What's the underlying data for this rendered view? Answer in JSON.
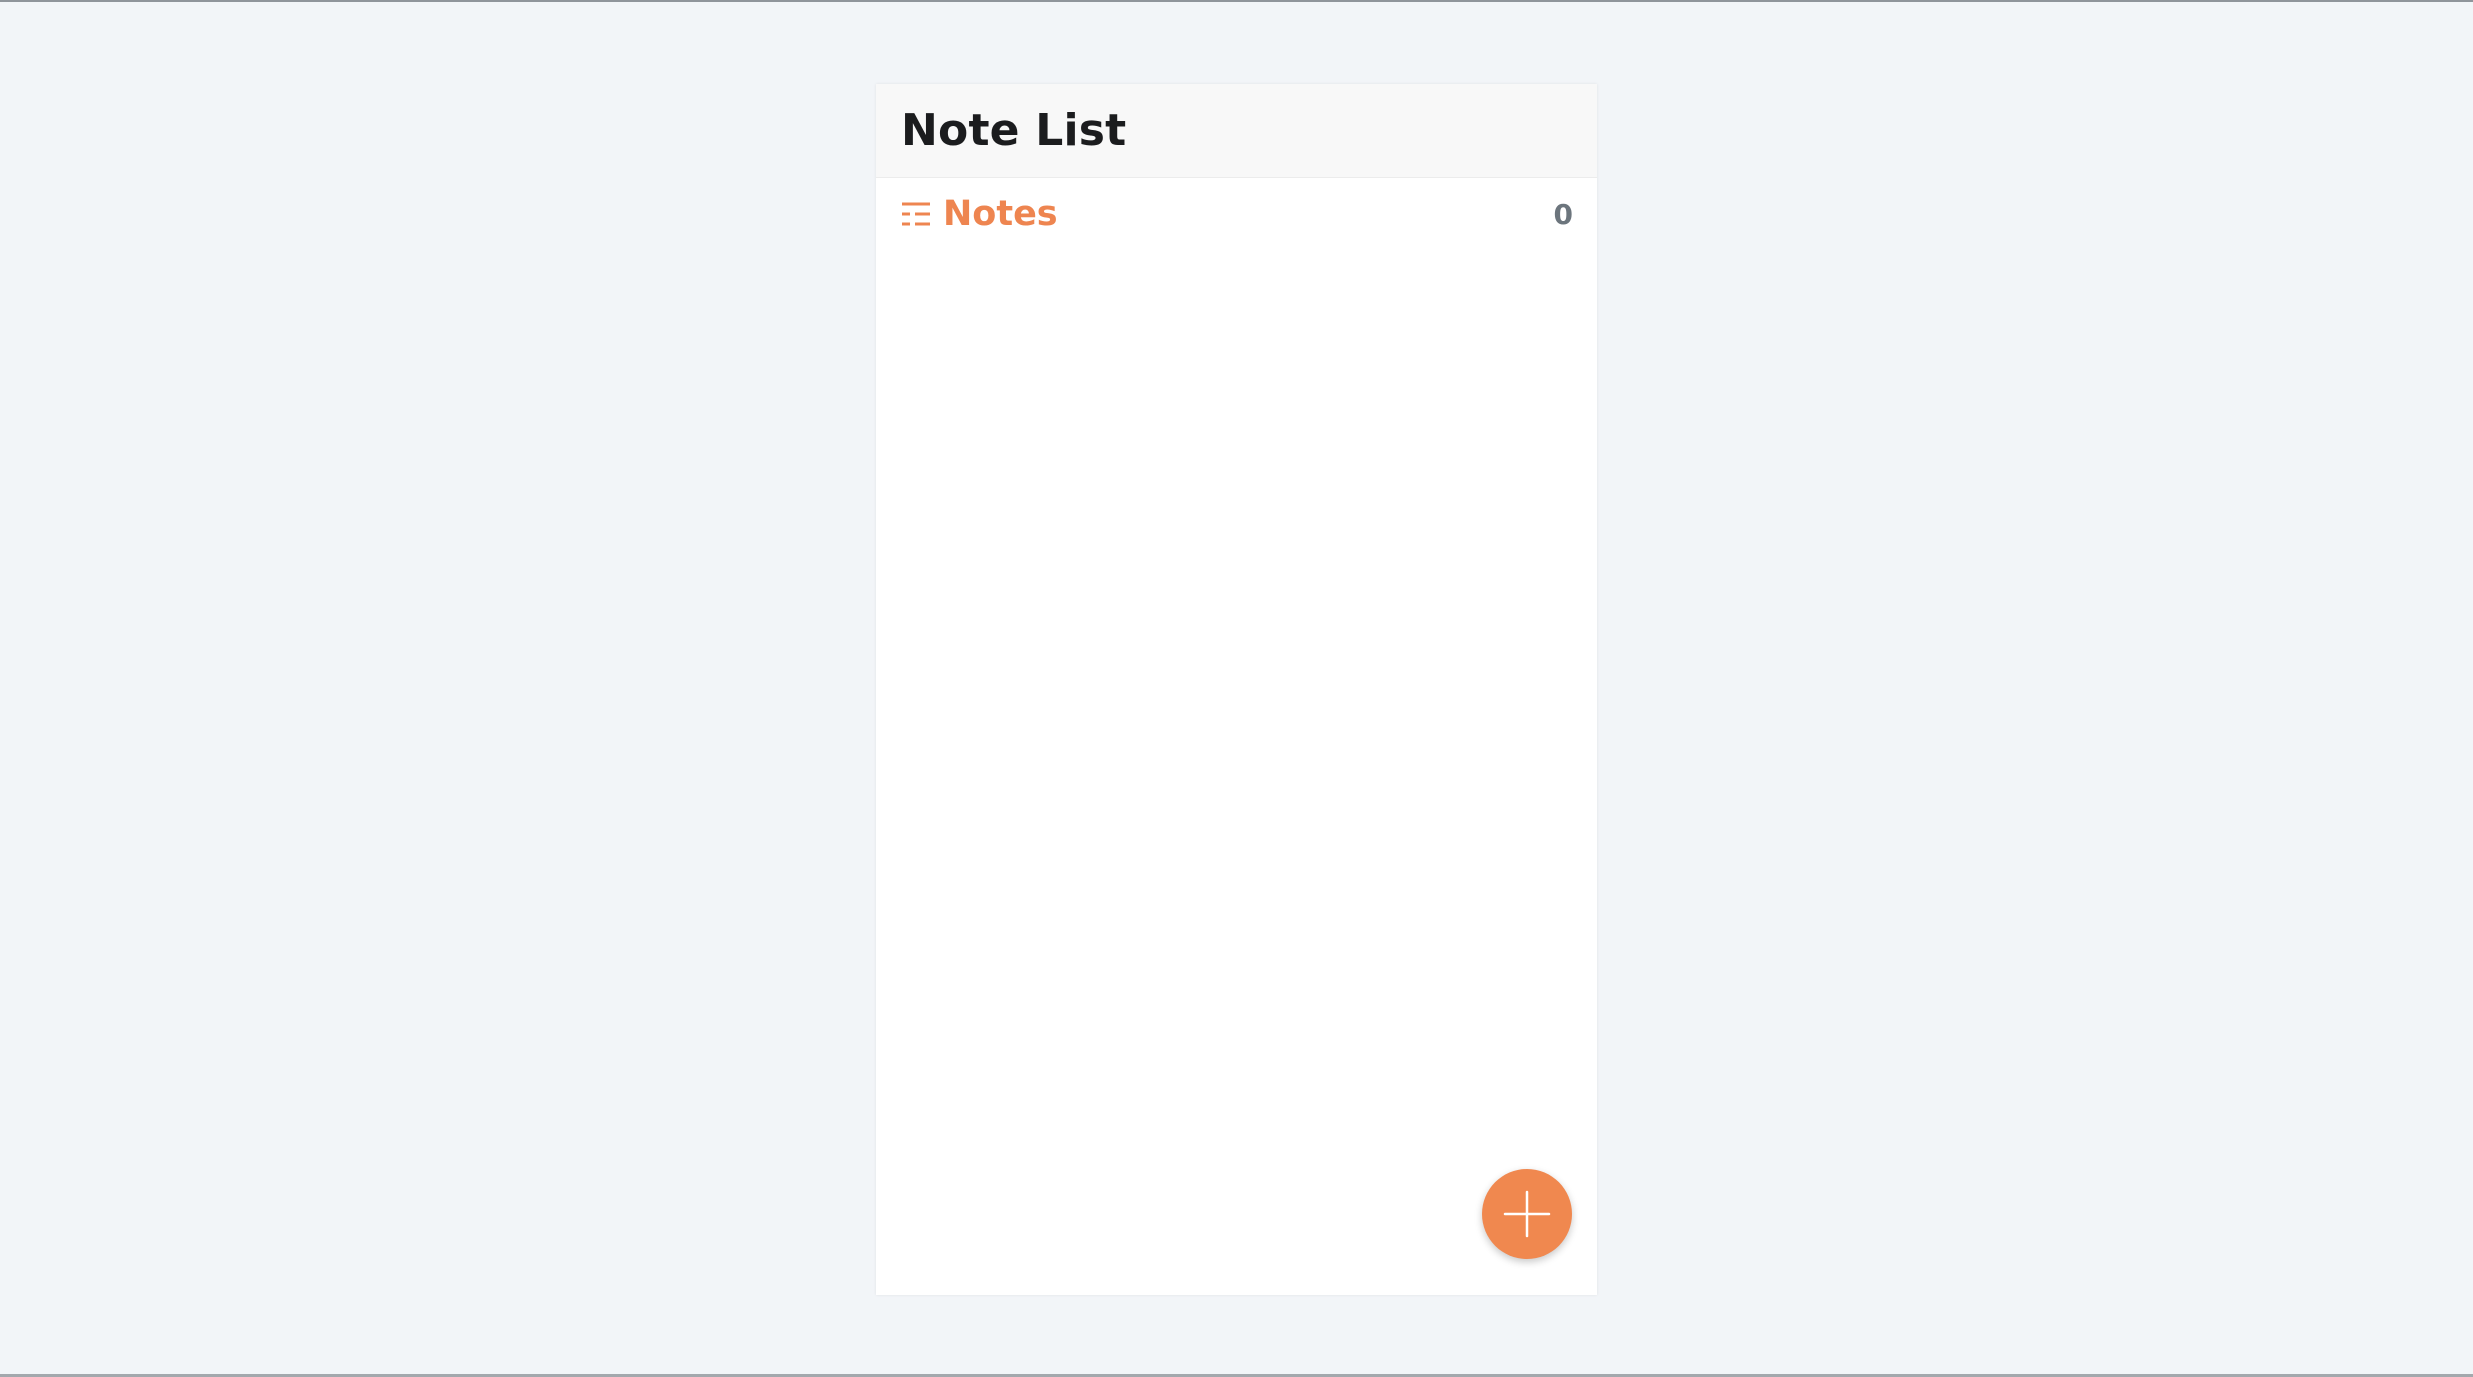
{
  "app": {
    "title": "Note List"
  },
  "notes_section": {
    "label": "Notes",
    "count": "0",
    "icon": "list-icon"
  },
  "fab": {
    "icon": "plus-icon"
  },
  "colors": {
    "accent": "#f0884f",
    "title_text": "#1b1c1e",
    "count_text": "#6c757d",
    "background": "#f2f5f8"
  }
}
